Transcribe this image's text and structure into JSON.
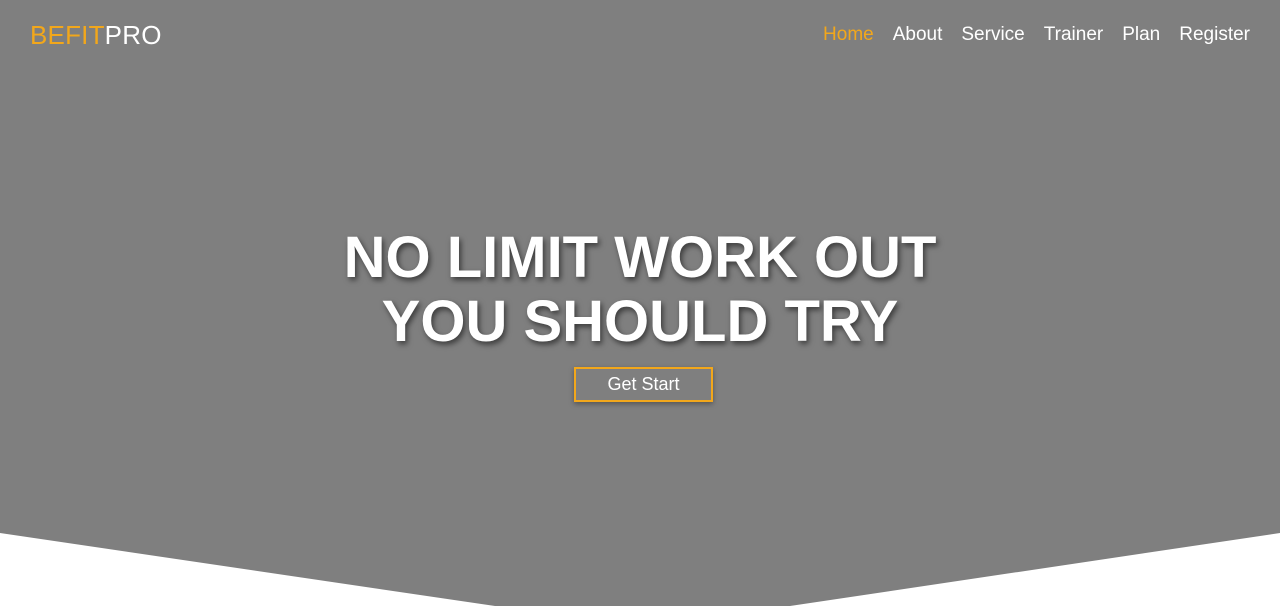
{
  "brand": {
    "accent_text": "BEFIT",
    "rest_text": "PRO"
  },
  "nav": {
    "items": [
      {
        "label": "Home",
        "active": true
      },
      {
        "label": "About",
        "active": false
      },
      {
        "label": "Service",
        "active": false
      },
      {
        "label": "Trainer",
        "active": false
      },
      {
        "label": "Plan",
        "active": false
      },
      {
        "label": "Register",
        "active": false
      }
    ]
  },
  "hero": {
    "headline_line1": "NO LIMIT WORK OUT",
    "headline_line2": "YOU SHOULD TRY",
    "cta_label": "Get Start"
  },
  "colors": {
    "accent": "#f2a71b",
    "hero_background": "#7f7f7f",
    "page_background": "#ffffff",
    "text": "#ffffff"
  }
}
